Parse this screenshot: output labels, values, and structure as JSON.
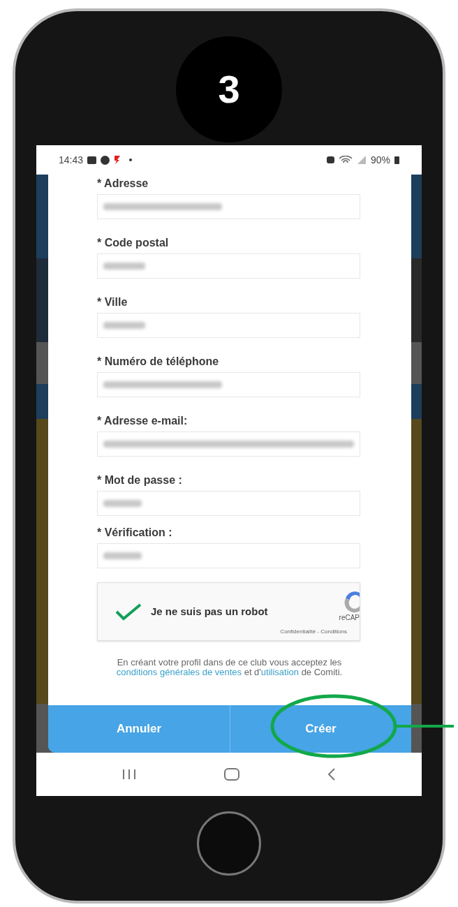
{
  "step_badge": "3",
  "status_bar": {
    "time": "14:43",
    "battery": "90%"
  },
  "fields": [
    {
      "label": "* Adresse",
      "kind": "text",
      "blurred": true
    },
    {
      "label": "* Code postal",
      "kind": "short",
      "blurred": true
    },
    {
      "label": "* Ville",
      "kind": "short",
      "blurred": true
    },
    {
      "label": "* Numéro de téléphone",
      "kind": "text",
      "blurred": true
    },
    {
      "label": "* Adresse e-mail:",
      "kind": "email",
      "blurred": true
    },
    {
      "label": "* Mot de passe :",
      "kind": "password",
      "blurred": true
    },
    {
      "label": "* Vérification :",
      "kind": "password",
      "blurred": true
    }
  ],
  "captcha": {
    "label": "Je ne suis pas un robot",
    "checked": true,
    "brand": "reCAP",
    "links": "Confidentialité - Conditions"
  },
  "terms": [
    {
      "kind": "text",
      "text": "En créant votre profil dans de ce club vous acceptez les "
    },
    {
      "kind": "link",
      "text": "conditions générales de ventes"
    },
    {
      "kind": "text",
      "text": " et d'"
    },
    {
      "kind": "link",
      "text": "utilisation"
    },
    {
      "kind": "text",
      "text": " de Comiti."
    }
  ],
  "buttons": [
    {
      "label": "Annuler",
      "highlighted": false
    },
    {
      "label": "Créer",
      "highlighted": true
    }
  ]
}
